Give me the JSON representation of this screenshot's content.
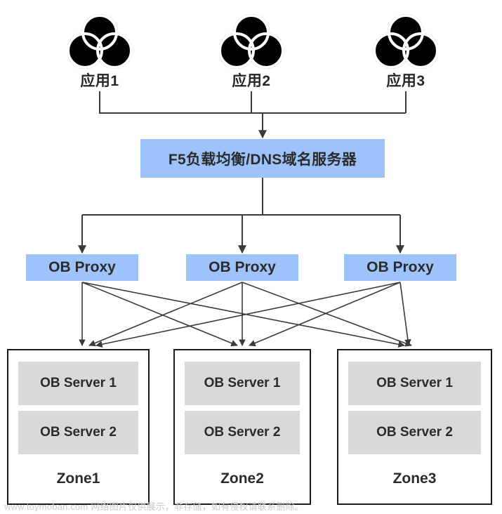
{
  "diagram": {
    "applications": [
      {
        "label": "应用1",
        "icon": "venn-three-circles-icon"
      },
      {
        "label": "应用2",
        "icon": "venn-three-circles-icon"
      },
      {
        "label": "应用3",
        "icon": "venn-three-circles-icon"
      }
    ],
    "load_balancer": {
      "label": "F5负载均衡/DNS域名服务器",
      "fill_color": "#9EC3FB"
    },
    "proxies": [
      {
        "label": "OB Proxy"
      },
      {
        "label": "OB Proxy"
      },
      {
        "label": "OB Proxy"
      }
    ],
    "zones": [
      {
        "label": "Zone1",
        "servers": [
          "OB Server 1",
          "OB Server 2"
        ]
      },
      {
        "label": "Zone2",
        "servers": [
          "OB Server 1",
          "OB Server 2"
        ]
      },
      {
        "label": "Zone3",
        "servers": [
          "OB Server 1",
          "OB Server 2"
        ]
      }
    ],
    "colors": {
      "blue_fill": "#9EC3FB",
      "gray_fill": "#D9D9D9",
      "line": "#3a3a3a",
      "border": "#1a1a1a",
      "text": "#2b2b2b"
    }
  },
  "watermark": {
    "text": "www.toymoban.com 网络图片仅供展示，非存储，如有侵权请联系删除。"
  }
}
